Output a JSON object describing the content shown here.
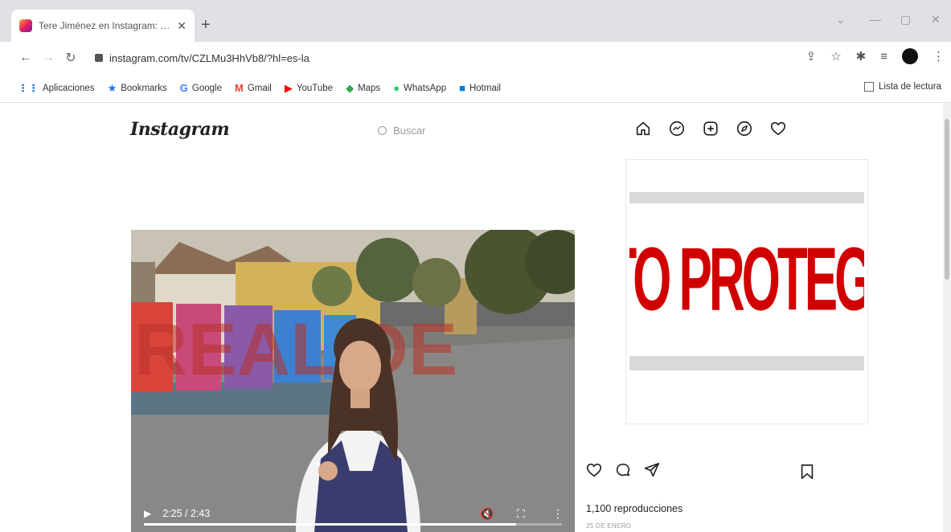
{
  "browser": {
    "tab_title": "Tere Jiménez en Instagram: \"Est",
    "tab_close": "✕",
    "new_tab": "+",
    "url": "instagram.com/tv/CZLMu3HhVb8/?hl=es-la",
    "bookmarks": [
      {
        "label": "Aplicaciones",
        "icon": "apps-icon",
        "glyph": "⋮⋮",
        "color": "#1a73e8"
      },
      {
        "label": "Bookmarks",
        "icon": "star-icon",
        "glyph": "★",
        "color": "#1a73e8"
      },
      {
        "label": "Google",
        "icon": "google-icon",
        "glyph": "G",
        "color": "#4285f4"
      },
      {
        "label": "Gmail",
        "icon": "gmail-icon",
        "glyph": "M",
        "color": "#ea4335"
      },
      {
        "label": "YouTube",
        "icon": "youtube-icon",
        "glyph": "▶",
        "color": "#ff0000"
      },
      {
        "label": "Maps",
        "icon": "maps-icon",
        "glyph": "◆",
        "color": "#34a853"
      },
      {
        "label": "WhatsApp",
        "icon": "whatsapp-icon",
        "glyph": "●",
        "color": "#25d366"
      },
      {
        "label": "Hotmail",
        "icon": "hotmail-icon",
        "glyph": "■",
        "color": "#0078d4"
      }
    ],
    "reading_list": "Lista de lectura"
  },
  "instagram": {
    "logo": "Instagram",
    "search_placeholder": "Buscar"
  },
  "video": {
    "time": "2:25 / 2:43",
    "progress": 0.89,
    "sign_text": "REAL DE"
  },
  "post": {
    "protected_label": "DATO PROTEGIDO",
    "views": "1,100 reproducciones",
    "date": "25 DE ENERO"
  },
  "colors": {
    "protected_red": "#d10000",
    "sign_red": "#d9453b",
    "sign_pink": "#c94a7a",
    "sign_purple": "#8a5aa8",
    "sign_blue": "#3d7fd1"
  }
}
